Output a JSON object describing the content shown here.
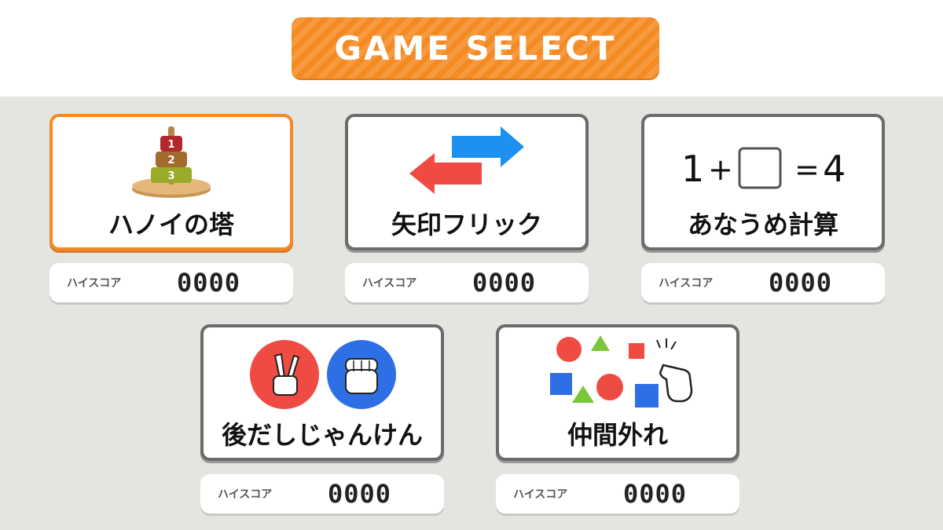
{
  "header": {
    "title": "GAME SELECT"
  },
  "high_score_label": "ハイスコア",
  "games": [
    {
      "id": "hanoi",
      "label": "ハノイの塔",
      "score": "0000",
      "selected": true,
      "art": {
        "icon": "tower-of-hanoi-icon",
        "disks": [
          "1",
          "2",
          "3"
        ]
      }
    },
    {
      "id": "arrow",
      "label": "矢印フリック",
      "score": "0000",
      "selected": false,
      "art": {
        "icon": "arrows-icon"
      }
    },
    {
      "id": "math",
      "label": "あなうめ計算",
      "score": "0000",
      "selected": false,
      "art": {
        "icon": "equation-icon",
        "left": "1",
        "plus": "+",
        "equals": "=",
        "result": "4"
      }
    },
    {
      "id": "janken",
      "label": "後だしじゃんけん",
      "score": "0000",
      "selected": false,
      "art": {
        "icon": "janken-hands-icon"
      }
    },
    {
      "id": "odd",
      "label": "仲間外れ",
      "score": "0000",
      "selected": false,
      "art": {
        "icon": "shapes-pointer-icon"
      }
    }
  ],
  "colors": {
    "accent": "#f48a24",
    "red": "#ef4b43",
    "blue": "#2f6fe6",
    "green": "#7cc63a"
  }
}
